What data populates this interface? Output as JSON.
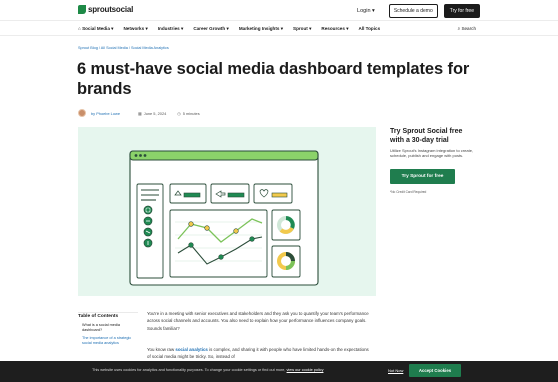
{
  "header": {
    "logo_text": "sproutsocial",
    "login_label": "Login",
    "demo_label": "Schedule a demo",
    "try_label": "Try for free"
  },
  "nav": {
    "items": [
      "Social Media",
      "Networks",
      "Industries",
      "Career Growth",
      "Marketing Insights",
      "Sprout",
      "Resources",
      "All Topics"
    ],
    "search_label": "Search"
  },
  "article": {
    "breadcrumb": "Sprout Blog / All Social Media / Social Media Analytics",
    "title": "6 must-have social media dashboard templates for brands",
    "author": "by Phoebe Lowe",
    "date": "June 5, 2024",
    "read_time": "5 minutes"
  },
  "promo": {
    "title": "Try Sprout Social free with a 30-day trial",
    "body": "Utilize Sprout's Instagram integration to create, schedule, publish and engage with posts.",
    "button": "Try Sprout for free",
    "note": "*No Credit Card Required"
  },
  "toc": {
    "title": "Table of Contents",
    "item1": "What is a social media dashboard?",
    "item2": "The importance of a strategic social media analytics"
  },
  "body": {
    "p1": "You're in a meeting with senior executives and stakeholders and they ask you to quantify your team's performance across social channels and accounts. You also need to explain how your performance influences company goals. Sounds familiar?",
    "p2_pre": "You know raw ",
    "p2_link": "social analytics",
    "p2_post": " is complex, and sharing it with people who have limited hands-on the expectations of social media might be tricky. So, instead of"
  },
  "cookie": {
    "text": "This website uses cookies for analytics and functionality purposes. To change your cookie settings or find out more,",
    "link": "view our cookie policy",
    "not_now": "Not Now",
    "accept": "Accept Cookies"
  },
  "colors": {
    "brand_green": "#1f7d4e",
    "hero_bg": "#e6f6ee",
    "link_blue": "#1e6fb3"
  }
}
